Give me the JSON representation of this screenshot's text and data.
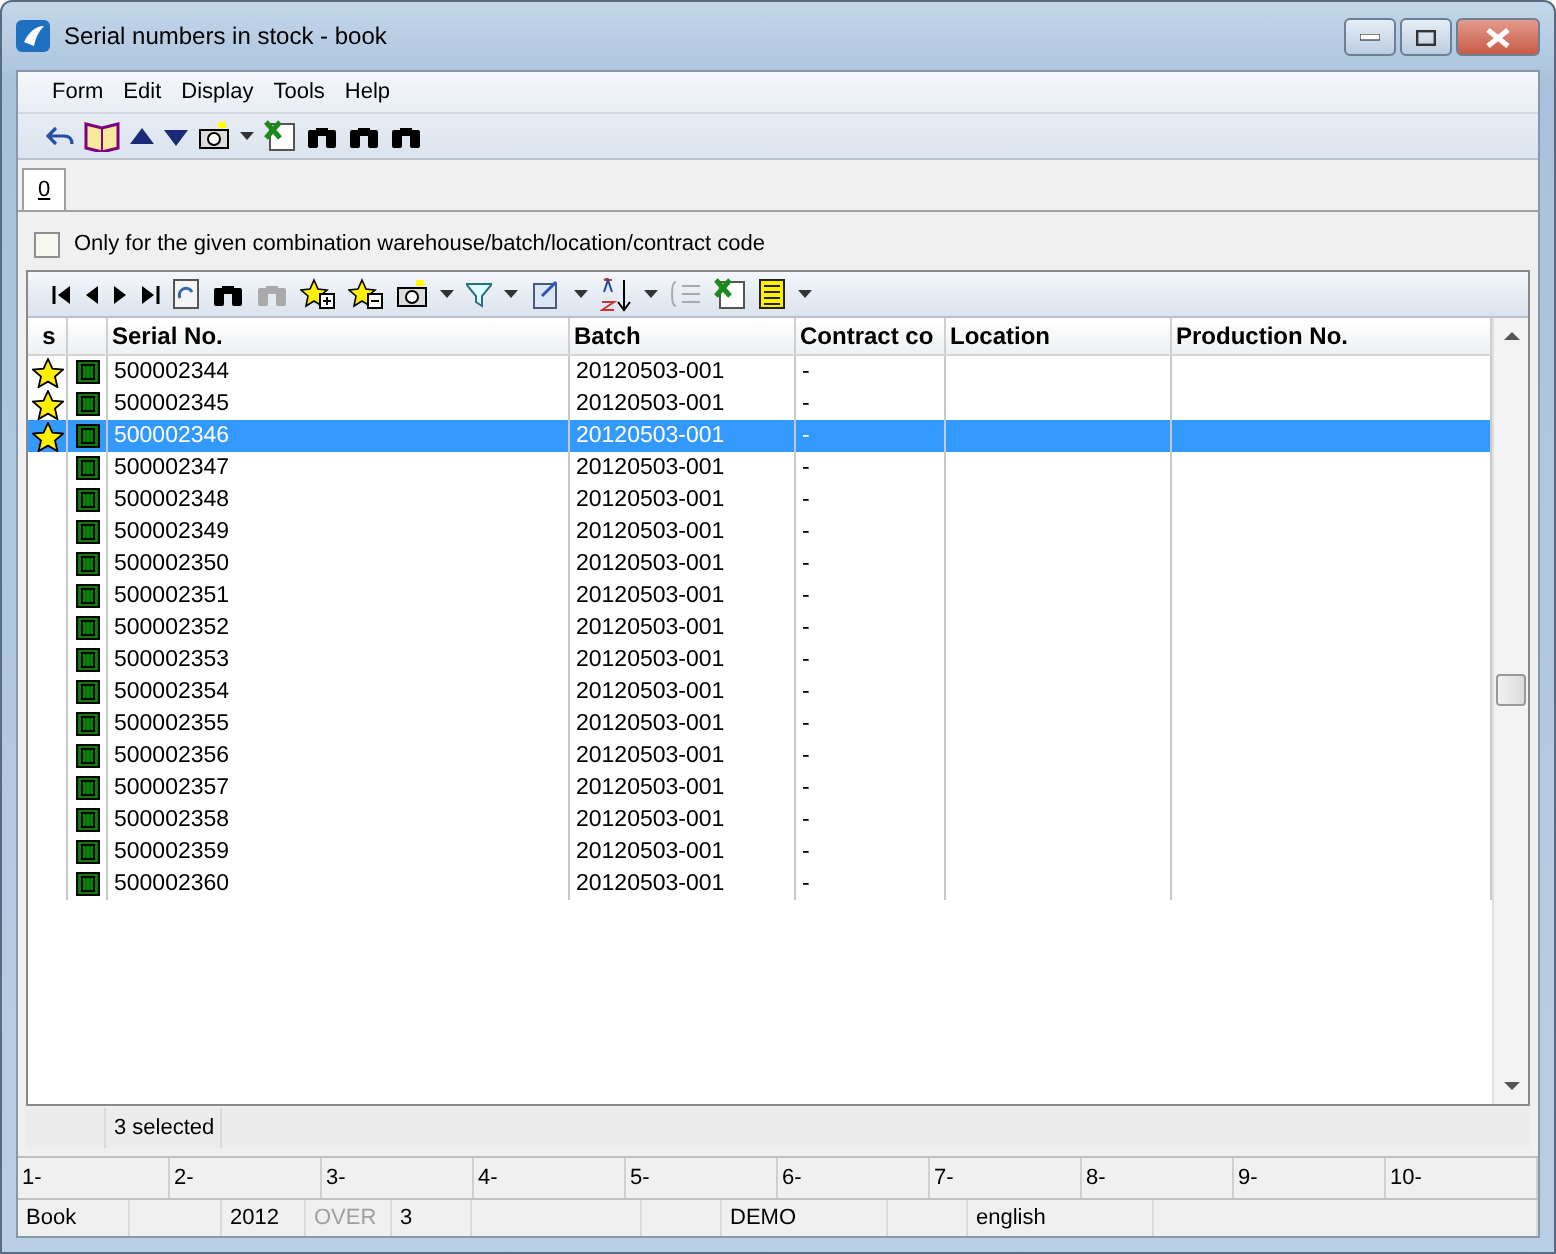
{
  "window": {
    "title": "Serial numbers in stock - book"
  },
  "menu": [
    "Form",
    "Edit",
    "Display",
    "Tools",
    "Help"
  ],
  "tabs": [
    {
      "label": "0",
      "selected": true
    }
  ],
  "filter": {
    "label": "Only for the given combination warehouse/batch/location/contract code",
    "checked": false
  },
  "table": {
    "columns": [
      "s",
      "Serial No.",
      "Batch",
      "Contract co",
      "Location",
      "Production No."
    ],
    "rows": [
      {
        "marked": true,
        "selected": false,
        "serial": "500002344",
        "batch": "20120503-001",
        "contract": "-"
      },
      {
        "marked": true,
        "selected": false,
        "serial": "500002345",
        "batch": "20120503-001",
        "contract": "-"
      },
      {
        "marked": true,
        "selected": true,
        "serial": "500002346",
        "batch": "20120503-001",
        "contract": "-"
      },
      {
        "marked": false,
        "selected": false,
        "serial": "500002347",
        "batch": "20120503-001",
        "contract": "-"
      },
      {
        "marked": false,
        "selected": false,
        "serial": "500002348",
        "batch": "20120503-001",
        "contract": "-"
      },
      {
        "marked": false,
        "selected": false,
        "serial": "500002349",
        "batch": "20120503-001",
        "contract": "-"
      },
      {
        "marked": false,
        "selected": false,
        "serial": "500002350",
        "batch": "20120503-001",
        "contract": "-"
      },
      {
        "marked": false,
        "selected": false,
        "serial": "500002351",
        "batch": "20120503-001",
        "contract": "-"
      },
      {
        "marked": false,
        "selected": false,
        "serial": "500002352",
        "batch": "20120503-001",
        "contract": "-"
      },
      {
        "marked": false,
        "selected": false,
        "serial": "500002353",
        "batch": "20120503-001",
        "contract": "-"
      },
      {
        "marked": false,
        "selected": false,
        "serial": "500002354",
        "batch": "20120503-001",
        "contract": "-"
      },
      {
        "marked": false,
        "selected": false,
        "serial": "500002355",
        "batch": "20120503-001",
        "contract": "-"
      },
      {
        "marked": false,
        "selected": false,
        "serial": "500002356",
        "batch": "20120503-001",
        "contract": "-"
      },
      {
        "marked": false,
        "selected": false,
        "serial": "500002357",
        "batch": "20120503-001",
        "contract": "-"
      },
      {
        "marked": false,
        "selected": false,
        "serial": "500002358",
        "batch": "20120503-001",
        "contract": "-"
      },
      {
        "marked": false,
        "selected": false,
        "serial": "500002359",
        "batch": "20120503-001",
        "contract": "-"
      },
      {
        "marked": false,
        "selected": false,
        "serial": "500002360",
        "batch": "20120503-001",
        "contract": "-"
      }
    ]
  },
  "selection_count": "3 selected",
  "function_keys": [
    "1-",
    "2-",
    "3-",
    "4-",
    "5-",
    "6-",
    "7-",
    "8-",
    "9-",
    "10-"
  ],
  "status_bar": [
    {
      "text": "Book",
      "disabled": false
    },
    {
      "text": "2012",
      "disabled": false
    },
    {
      "text": "OVER",
      "disabled": true
    },
    {
      "text": "3",
      "disabled": false
    },
    {
      "text": "DEMO",
      "disabled": false
    },
    {
      "text": "english",
      "disabled": false
    }
  ]
}
